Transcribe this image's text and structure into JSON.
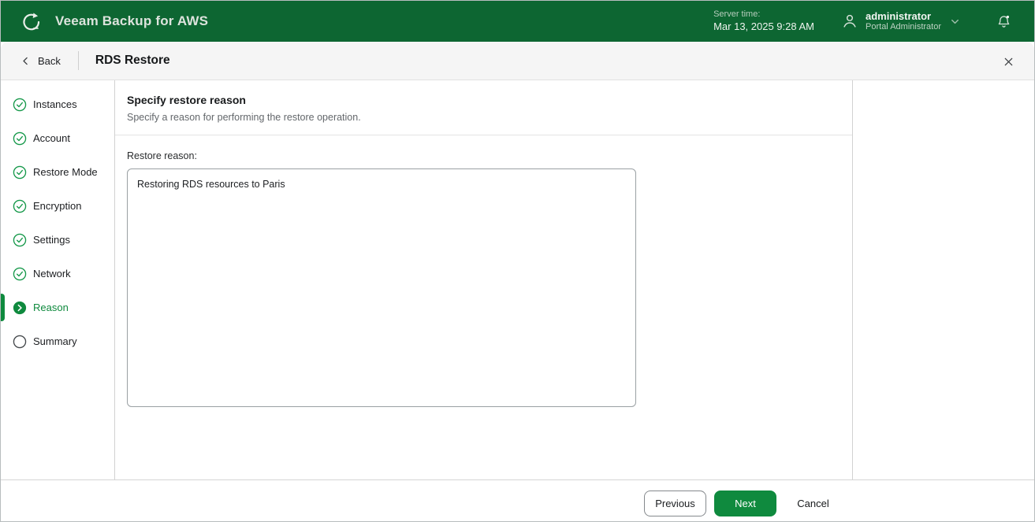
{
  "app": {
    "title": "Veeam Backup for AWS",
    "server_time_label": "Server time:",
    "server_time_value": "Mar 13, 2025 9:28 AM",
    "user_name": "administrator",
    "user_role": "Portal Administrator"
  },
  "toolbar": {
    "back_label": "Back",
    "page_title": "RDS Restore"
  },
  "wizard": {
    "steps": [
      {
        "label": "Instances",
        "state": "done"
      },
      {
        "label": "Account",
        "state": "done"
      },
      {
        "label": "Restore Mode",
        "state": "done"
      },
      {
        "label": "Encryption",
        "state": "done"
      },
      {
        "label": "Settings",
        "state": "done"
      },
      {
        "label": "Network",
        "state": "done"
      },
      {
        "label": "Reason",
        "state": "active"
      },
      {
        "label": "Summary",
        "state": "pending"
      }
    ]
  },
  "main": {
    "heading": "Specify restore reason",
    "subheading": "Specify a reason for performing the restore operation.",
    "reason_label": "Restore reason:",
    "reason_value": "Restoring RDS resources to Paris"
  },
  "footer": {
    "previous_label": "Previous",
    "next_label": "Next",
    "cancel_label": "Cancel"
  },
  "colors": {
    "header_green": "#0d6632",
    "brand_green": "#0f8a3e",
    "check_green": "#17994b",
    "toolbar_bg": "#f5f5f5"
  },
  "icons": {
    "logo": "veeam-logo-icon",
    "user": "user-icon",
    "dropdown": "chevron-down-icon",
    "notifications": "bell-icon",
    "back": "chevron-left-icon",
    "close": "close-icon",
    "step_done": "check-circle-icon",
    "step_active": "arrow-circle-icon",
    "step_pending": "empty-circle-icon"
  }
}
